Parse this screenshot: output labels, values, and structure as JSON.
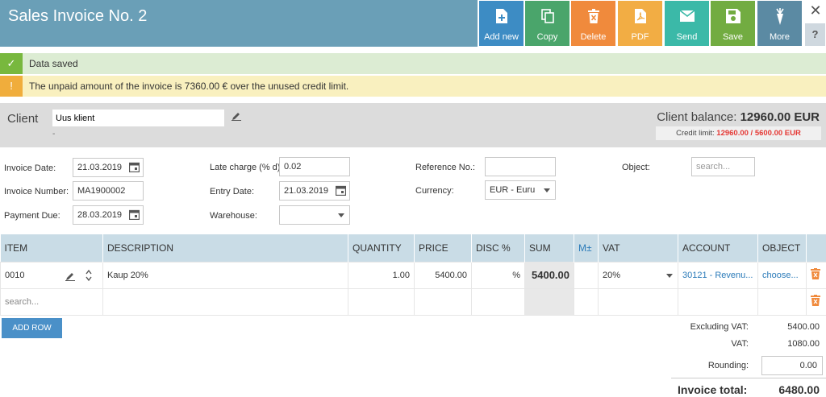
{
  "header": {
    "title": "Sales Invoice No. 2",
    "buttons": [
      {
        "label": "Add new",
        "color": "#3d8cc4",
        "icon": "add-document-icon"
      },
      {
        "label": "Copy",
        "color": "#4aa56b",
        "icon": "copy-icon"
      },
      {
        "label": "Delete",
        "color": "#f08a3c",
        "icon": "trash-icon"
      },
      {
        "label": "PDF",
        "color": "#f2ad44",
        "icon": "pdf-icon"
      },
      {
        "label": "Send",
        "color": "#3bb9a8",
        "icon": "envelope-icon"
      },
      {
        "label": "Save",
        "color": "#72ac41",
        "icon": "floppy-icon"
      },
      {
        "label": "More",
        "color": "#5b8aa3",
        "icon": "carrot-icon"
      }
    ],
    "close": "✕",
    "help": "?"
  },
  "messages": {
    "saved": "Data saved",
    "saved_icon": "✓",
    "warning": "The unpaid amount of the invoice is 7360.00 € over the unused credit limit.",
    "warning_icon": "!"
  },
  "client": {
    "label": "Client",
    "name": "Uus klient",
    "sub": "-",
    "balance_label": "Client balance:",
    "balance_value": "12960.00 EUR",
    "credit_label": "Credit limit:",
    "credit_value": "12960.00 / 5600.00 EUR"
  },
  "form": {
    "invoice_date_label": "Invoice Date:",
    "invoice_date": "21.03.2019",
    "invoice_number_label": "Invoice Number:",
    "invoice_number": "MA1900002",
    "payment_due_label": "Payment Due:",
    "payment_due": "28.03.2019",
    "late_charge_label": "Late charge (% d):",
    "late_charge": "0.02",
    "entry_date_label": "Entry Date:",
    "entry_date": "21.03.2019",
    "warehouse_label": "Warehouse:",
    "warehouse": "",
    "reference_label": "Reference No.:",
    "reference": "",
    "currency_label": "Currency:",
    "currency": "EUR - Euru",
    "object_label": "Object:",
    "object_placeholder": "search..."
  },
  "grid": {
    "headers": [
      "ITEM",
      "DESCRIPTION",
      "QUANTITY",
      "PRICE",
      "DISC %",
      "SUM",
      "M±",
      "VAT",
      "ACCOUNT",
      "OBJECT",
      ""
    ],
    "row": {
      "item": "0010",
      "description": "Kaup 20%",
      "quantity": "1.00",
      "price": "5400.00",
      "disc": "%",
      "sum": "5400.00",
      "vat": "20%",
      "account": "30121 - Revenu...",
      "object": "choose..."
    },
    "search_placeholder": "search..."
  },
  "add_row": "ADD ROW",
  "totals": {
    "excl_vat_label": "Excluding VAT:",
    "excl_vat": "5400.00",
    "vat_label": "VAT:",
    "vat": "1080.00",
    "rounding_label": "Rounding:",
    "rounding": "0.00",
    "total_label": "Invoice total:",
    "total": "6480.00"
  }
}
